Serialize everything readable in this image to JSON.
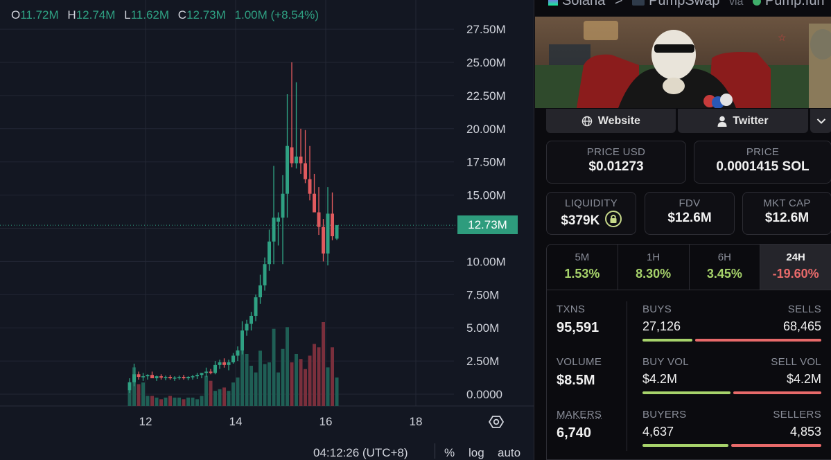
{
  "ohlc": {
    "o_label": "O",
    "o": "11.72M",
    "h_label": "H",
    "h": "12.74M",
    "l_label": "L",
    "l": "11.62M",
    "c_label": "C",
    "c": "12.73M",
    "change": "1.00M (+8.54%)"
  },
  "chart_data": {
    "type": "candlestick",
    "y_ticks": [
      "27.50M",
      "25.00M",
      "22.50M",
      "20.00M",
      "17.50M",
      "15.00M",
      "12.50M",
      "10.00M",
      "7.50M",
      "5.00M",
      "2.50M",
      "0.0000"
    ],
    "y_tick_values": [
      27.5,
      25,
      22.5,
      20,
      17.5,
      15,
      12.5,
      10,
      7.5,
      5,
      2.5,
      0
    ],
    "x_ticks": [
      "12",
      "14",
      "16",
      "18"
    ],
    "last_price": "12.73M",
    "last_price_value": 12.73,
    "colors": {
      "up": "#2fa183",
      "down": "#e05a5e",
      "vol_up": "#1f5f55",
      "vol_down": "#7a2f3c",
      "grid": "#232734"
    },
    "candles": [
      {
        "o": 0.3,
        "h": 1.2,
        "l": 0.1,
        "c": 0.9
      },
      {
        "o": 0.9,
        "h": 2.3,
        "l": 0.6,
        "c": 1.5
      },
      {
        "o": 1.5,
        "h": 1.7,
        "l": 1.1,
        "c": 1.3
      },
      {
        "o": 1.3,
        "h": 1.6,
        "l": 1.0,
        "c": 1.35
      },
      {
        "o": 1.35,
        "h": 1.5,
        "l": 1.1,
        "c": 1.45
      },
      {
        "o": 1.45,
        "h": 1.7,
        "l": 1.2,
        "c": 1.2
      },
      {
        "o": 1.2,
        "h": 1.4,
        "l": 1.0,
        "c": 1.35
      },
      {
        "o": 1.35,
        "h": 1.5,
        "l": 1.1,
        "c": 1.25
      },
      {
        "o": 1.25,
        "h": 1.4,
        "l": 1.05,
        "c": 1.3
      },
      {
        "o": 1.3,
        "h": 1.45,
        "l": 1.1,
        "c": 1.2
      },
      {
        "o": 1.2,
        "h": 1.35,
        "l": 1.0,
        "c": 1.25
      },
      {
        "o": 1.25,
        "h": 1.4,
        "l": 1.1,
        "c": 1.3
      },
      {
        "o": 1.3,
        "h": 1.45,
        "l": 1.1,
        "c": 1.2
      },
      {
        "o": 1.2,
        "h": 1.35,
        "l": 1.05,
        "c": 1.3
      },
      {
        "o": 1.3,
        "h": 1.45,
        "l": 1.1,
        "c": 1.35
      },
      {
        "o": 1.35,
        "h": 1.6,
        "l": 1.15,
        "c": 1.45
      },
      {
        "o": 1.45,
        "h": 1.6,
        "l": 1.2,
        "c": 1.6
      },
      {
        "o": 1.6,
        "h": 2.0,
        "l": 1.3,
        "c": 1.7
      },
      {
        "o": 1.7,
        "h": 1.9,
        "l": 1.5,
        "c": 1.6
      },
      {
        "o": 1.6,
        "h": 2.5,
        "l": 1.5,
        "c": 2.2
      },
      {
        "o": 2.2,
        "h": 2.6,
        "l": 1.9,
        "c": 2.4
      },
      {
        "o": 2.4,
        "h": 2.7,
        "l": 2.0,
        "c": 2.2
      },
      {
        "o": 2.2,
        "h": 2.6,
        "l": 1.8,
        "c": 2.4
      },
      {
        "o": 2.4,
        "h": 3.1,
        "l": 2.3,
        "c": 2.9
      },
      {
        "o": 2.9,
        "h": 3.6,
        "l": 2.5,
        "c": 3.3
      },
      {
        "o": 3.3,
        "h": 5.5,
        "l": 3.0,
        "c": 4.8
      },
      {
        "o": 4.8,
        "h": 5.6,
        "l": 4.4,
        "c": 5.3
      },
      {
        "o": 5.3,
        "h": 6.2,
        "l": 4.8,
        "c": 5.9
      },
      {
        "o": 5.9,
        "h": 7.5,
        "l": 5.5,
        "c": 7.3
      },
      {
        "o": 7.3,
        "h": 9.0,
        "l": 6.8,
        "c": 8.2
      },
      {
        "o": 8.2,
        "h": 10.3,
        "l": 7.8,
        "c": 9.8
      },
      {
        "o": 9.8,
        "h": 12.4,
        "l": 9.3,
        "c": 11.5
      },
      {
        "o": 11.5,
        "h": 17.2,
        "l": 9.8,
        "c": 13.3
      },
      {
        "o": 13.0,
        "h": 13.7,
        "l": 11.2,
        "c": 13.3
      },
      {
        "o": 13.3,
        "h": 16.5,
        "l": 9.8,
        "c": 15.1
      },
      {
        "o": 15.1,
        "h": 22.6,
        "l": 13.3,
        "c": 18.7
      },
      {
        "o": 18.6,
        "h": 25.0,
        "l": 17.1,
        "c": 17.4
      },
      {
        "o": 17.4,
        "h": 23.5,
        "l": 17.0,
        "c": 17.9
      },
      {
        "o": 17.9,
        "h": 20.0,
        "l": 16.6,
        "c": 17.4
      },
      {
        "o": 17.4,
        "h": 19.9,
        "l": 15.9,
        "c": 16.2
      },
      {
        "o": 16.2,
        "h": 18.7,
        "l": 14.6,
        "c": 15.1
      },
      {
        "o": 15.1,
        "h": 16.6,
        "l": 14.3,
        "c": 13.7
      },
      {
        "o": 13.7,
        "h": 15.6,
        "l": 12.0,
        "c": 12.6
      },
      {
        "o": 12.6,
        "h": 13.2,
        "l": 10.0,
        "c": 10.6
      },
      {
        "o": 10.6,
        "h": 15.6,
        "l": 9.7,
        "c": 13.6
      },
      {
        "o": 13.6,
        "h": 15.2,
        "l": 11.6,
        "c": 11.9
      },
      {
        "o": 11.72,
        "h": 12.74,
        "l": 11.62,
        "c": 12.73
      }
    ],
    "volumes": [
      1.0,
      2.3,
      1.3,
      1.4,
      0.6,
      0.6,
      0.5,
      0.4,
      0.5,
      0.6,
      0.5,
      0.5,
      0.4,
      0.5,
      0.5,
      0.4,
      0.6,
      1.8,
      1.5,
      0.9,
      1.0,
      1.1,
      0.9,
      1.4,
      1.7,
      4.0,
      3.1,
      2.4,
      2.0,
      3.3,
      2.5,
      2.6,
      4.6,
      2.0,
      3.4,
      4.7,
      2.6,
      3.1,
      2.8,
      2.2,
      3.0,
      3.7,
      3.5,
      5.0,
      2.3,
      3.5,
      1.7,
      0.1
    ]
  },
  "bottom_bar": {
    "time": "04:12:26 (UTC+8)",
    "percent": "%",
    "log": "log",
    "auto": "auto"
  },
  "crumb": {
    "chain": "Solana",
    "sep": ">",
    "dex": "PumpSwap",
    "via": "via",
    "launchpad": "Pump.fun"
  },
  "links": {
    "website": "Website",
    "twitter": "Twitter"
  },
  "price": {
    "usd_label": "PRICE USD",
    "usd": "$0.01273",
    "native_label": "PRICE",
    "native": "0.0001415 SOL"
  },
  "metrics": {
    "liq_label": "LIQUIDITY",
    "liq": "$379K",
    "fdv_label": "FDV",
    "fdv": "$12.6M",
    "mcap_label": "MKT CAP",
    "mcap": "$12.6M"
  },
  "timeframes": [
    {
      "label": "5M",
      "value": "1.53%",
      "color": "#a7d36b"
    },
    {
      "label": "1H",
      "value": "8.30%",
      "color": "#a7d36b"
    },
    {
      "label": "6H",
      "value": "3.45%",
      "color": "#a7d36b"
    },
    {
      "label": "24H",
      "value": "-19.60%",
      "color": "#e86a6a"
    }
  ],
  "stats": {
    "txns_label": "TXNS",
    "txns": "95,591",
    "buys_label": "BUYS",
    "buys": "27,126",
    "sells_label": "SELLS",
    "sells": "68,465",
    "buys_ratio": 0.284,
    "volume_label": "VOLUME",
    "volume": "$8.5M",
    "buyvol_label": "BUY VOL",
    "buyvol": "$4.2M",
    "sellvol_label": "SELL VOL",
    "sellvol": "$4.2M",
    "vol_ratio": 0.5,
    "makers_label": "MAKERS",
    "makers": "6,740",
    "buyers_label": "BUYERS",
    "buyers": "4,637",
    "sellers_label": "SELLERS",
    "sellers": "4,853",
    "buyers_ratio": 0.489
  }
}
